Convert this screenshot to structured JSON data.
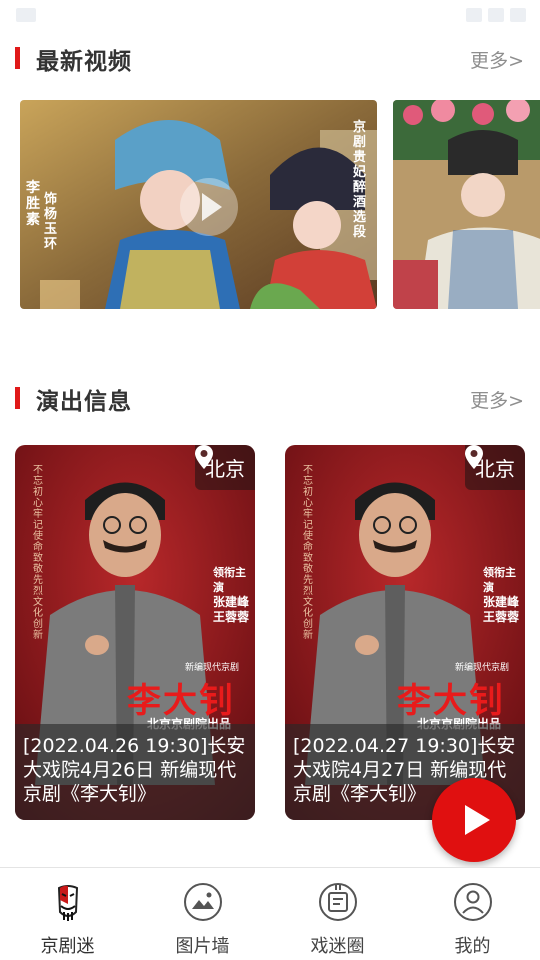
{
  "sections": {
    "latest_videos": {
      "title": "最新视频",
      "more": "更多>"
    },
    "performances": {
      "title": "演出信息",
      "more": "更多>"
    }
  },
  "videos": [
    {
      "overlay_text_1": "饰杨玉环",
      "overlay_text_2": "李胜素",
      "overlay_text_3": "京剧贵妃醉酒选段"
    },
    {}
  ],
  "performances": [
    {
      "city": "北京",
      "caption": "[2022.04.26 19:30]长安大戏院4月26日 新编现代京剧《李大钊》",
      "poster": {
        "title": "李大钊",
        "subtitle": "新编现代京剧",
        "producer": "北京京剧院出品",
        "lead": "领衔主演",
        "actors": "张建峰 王蓉蓉",
        "slogan": "不忘初心 牢记使命 致敬先烈 文化创新"
      }
    },
    {
      "city": "北京",
      "caption": "[2022.04.27 19:30]长安大戏院4月27日 新编现代京剧《李大钊》",
      "poster": {
        "title": "李大钊",
        "subtitle": "新编现代京剧",
        "producer": "北京京剧院出品",
        "lead": "领衔主演",
        "actors": "张建峰 王蓉蓉",
        "slogan": "不忘初心 牢记使命 致敬先烈 文化创新"
      }
    }
  ],
  "tabs": [
    {
      "label": "京剧迷",
      "icon": "opera-mask-icon",
      "active": true
    },
    {
      "label": "图片墙",
      "icon": "image-icon",
      "active": false
    },
    {
      "label": "戏迷圈",
      "icon": "chat-circle-icon",
      "active": false
    },
    {
      "label": "我的",
      "icon": "user-icon",
      "active": false
    }
  ],
  "colors": {
    "accent": "#e01919",
    "fab": "#e01010",
    "poster_red": "#9b1b1b"
  }
}
